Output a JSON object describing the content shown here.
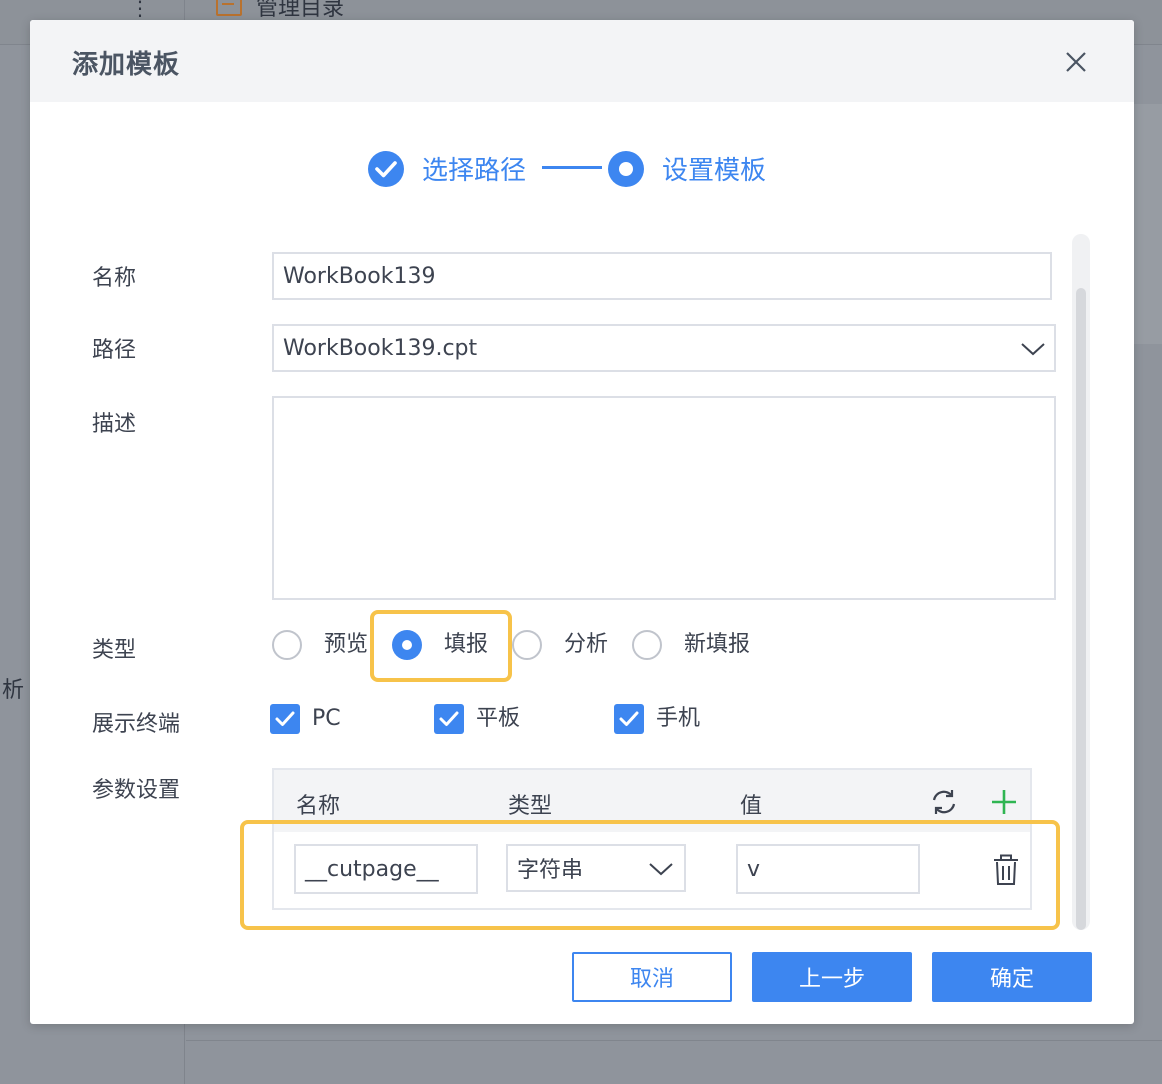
{
  "background": {
    "top_item": "管理目录",
    "side_text": "析"
  },
  "dialog": {
    "title": "添加模板",
    "steps": [
      {
        "label": "选择路径",
        "state": "done"
      },
      {
        "label": "设置模板",
        "state": "active"
      }
    ],
    "form": {
      "name_label": "名称",
      "name_value": "WorkBook139",
      "path_label": "路径",
      "path_value": "WorkBook139.cpt",
      "desc_label": "描述",
      "desc_value": "",
      "type_label": "类型",
      "type_options": [
        "预览",
        "填报",
        "分析",
        "新填报"
      ],
      "type_selected": "填报",
      "terminal_label": "展示终端",
      "terminals": [
        {
          "label": "PC",
          "checked": true
        },
        {
          "label": "平板",
          "checked": true
        },
        {
          "label": "手机",
          "checked": true
        }
      ],
      "params_label": "参数设置"
    },
    "params_table": {
      "headers": [
        "名称",
        "类型",
        "值"
      ],
      "rows": [
        {
          "name": "__cutpage__",
          "type": "字符串",
          "value": "v"
        }
      ]
    },
    "buttons": {
      "cancel": "取消",
      "prev": "上一步",
      "ok": "确定"
    }
  },
  "colors": {
    "accent": "#3d86f0",
    "highlight": "#f7c34a",
    "add_icon": "#2fb552",
    "overlay_bg": "#8f949c"
  },
  "icons": [
    "close-icon",
    "check-icon",
    "chevron-down-icon",
    "refresh-icon",
    "plus-icon",
    "trash-icon"
  ]
}
